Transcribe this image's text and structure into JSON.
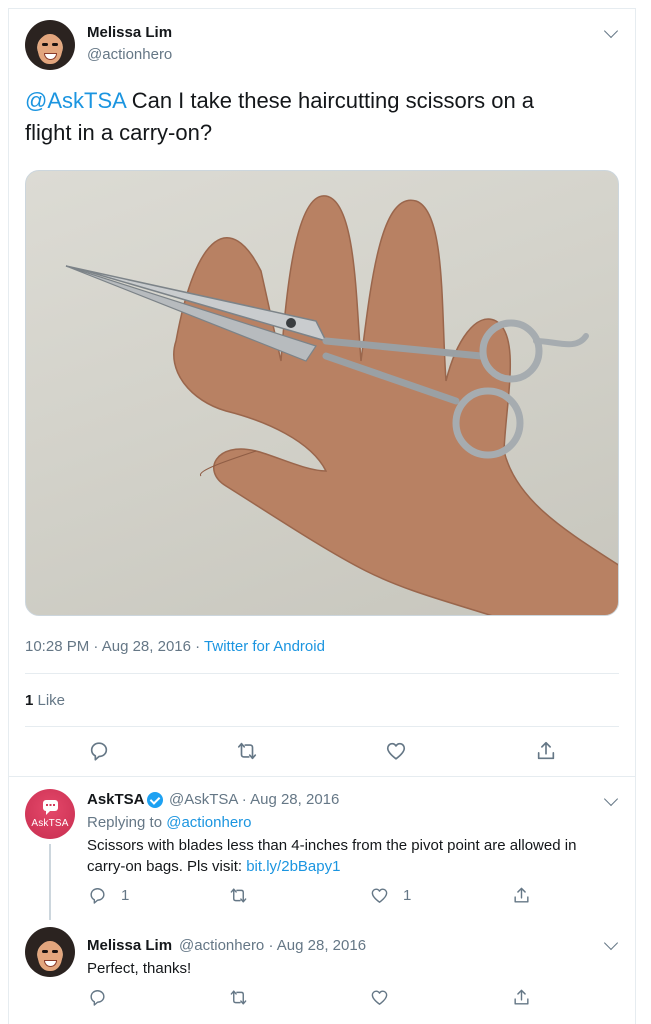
{
  "main_tweet": {
    "author_name": "Melissa Lim",
    "author_handle": "@actionhero",
    "mention": "@AskTSA",
    "text": " Can I take these haircutting scissors on a flight in a carry-on?",
    "time": "10:28 PM",
    "date_sep": " · ",
    "date": "Aug 28, 2016",
    "source_sep": " · ",
    "source": "Twitter for Android",
    "likes_count": "1",
    "likes_label": " Like"
  },
  "reply_tsa": {
    "author_name": "AskTSA",
    "author_handle": "@AskTSA",
    "sep": " · ",
    "date": "Aug 28, 2016",
    "replying_prefix": "Replying to ",
    "replying_to": "@actionhero",
    "text": "Scissors with blades less than 4-inches from the pivot point are allowed in carry-on bags. Pls visit: ",
    "link": "bit.ly/2bBapy1",
    "avatar_label": "AskTSA",
    "reply_count": "1",
    "like_count": "1"
  },
  "reply_melissa": {
    "author_name": "Melissa Lim",
    "author_handle": "@actionhero",
    "sep": " · ",
    "date": "Aug 28, 2016",
    "text": "Perfect, thanks!"
  },
  "colors": {
    "link": "#1b95e0",
    "muted": "#657786",
    "border": "#e6ecf0",
    "asktsa_brand": "#d63a5c"
  },
  "icons": [
    "chevron-down-icon",
    "reply-icon",
    "retweet-icon",
    "like-icon",
    "share-icon",
    "verified-icon",
    "asktsa-logo-icon"
  ]
}
